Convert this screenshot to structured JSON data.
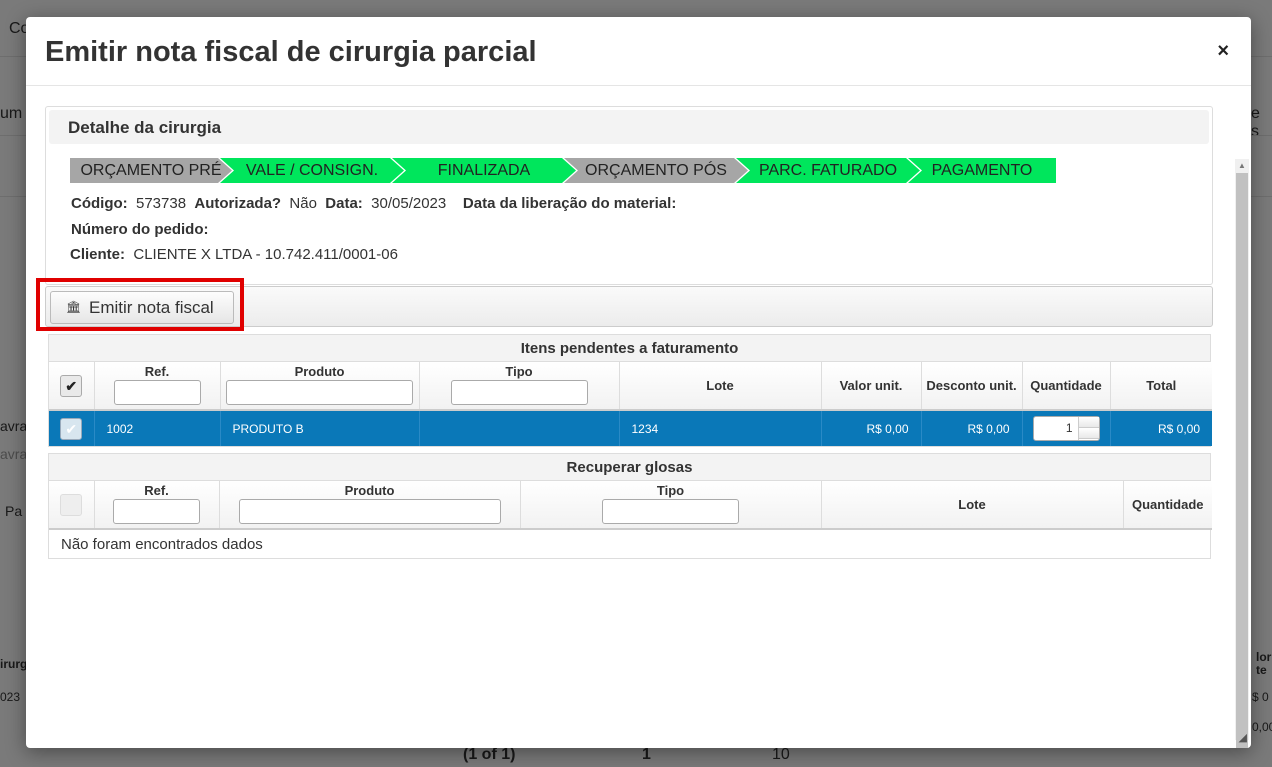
{
  "background": {
    "fragments": [
      "Co",
      "um",
      "e s",
      "avra",
      "avra",
      "Pa",
      "irurg",
      "023",
      "lor",
      "te",
      "$ 0",
      "0,00"
    ],
    "pagination": {
      "text": "(1 of 1)",
      "page": "1",
      "rows": "10"
    }
  },
  "modal": {
    "title": "Emitir nota fiscal de cirurgia parcial",
    "close_icon": "×"
  },
  "detail": {
    "legend": "Detalhe da cirurgia",
    "steps": [
      {
        "label": "ORÇAMENTO PRÉ",
        "color": "#a6a6a6"
      },
      {
        "label": "VALE / CONSIGN.",
        "color": "#00e65c"
      },
      {
        "label": "FINALIZADA",
        "color": "#00e65c"
      },
      {
        "label": "ORÇAMENTO PÓS",
        "color": "#a6a6a6"
      },
      {
        "label": "PARC. FATURADO",
        "color": "#00e65c"
      },
      {
        "label": "PAGAMENTO",
        "color": "#00e65c"
      }
    ],
    "codigo_label": "Código:",
    "codigo_value": "573738",
    "autorizada_label": "Autorizada?",
    "autorizada_value": "Não",
    "data_label": "Data:",
    "data_value": "30/05/2023",
    "liberacao_label": "Data da liberação do material:",
    "pedido_label": "Número do pedido:",
    "cliente_label": "Cliente:",
    "cliente_value": "CLIENTE X LTDA - 10.742.411/0001-06"
  },
  "toolbar": {
    "emit_label": "Emitir nota fiscal",
    "emit_icon": "bank-icon"
  },
  "pending_table": {
    "caption": "Itens pendentes a faturamento",
    "headers": {
      "ref": "Ref.",
      "produto": "Produto",
      "tipo": "Tipo",
      "lote": "Lote",
      "valor_unit": "Valor unit.",
      "desconto_unit": "Desconto unit.",
      "quantidade": "Quantidade",
      "total": "Total"
    },
    "rows": [
      {
        "ref": "1002",
        "produto": "PRODUTO B",
        "tipo": "",
        "lote": "1234",
        "valor_unit": "R$ 0,00",
        "desconto_unit": "R$ 0,00",
        "quantidade": "1",
        "total": "R$ 0,00"
      }
    ]
  },
  "glosas_table": {
    "caption": "Recuperar glosas",
    "headers": {
      "ref": "Ref.",
      "produto": "Produto",
      "tipo": "Tipo",
      "lote": "Lote",
      "quantidade": "Quantidade"
    },
    "empty_message": "Não foram encontrados dados"
  }
}
